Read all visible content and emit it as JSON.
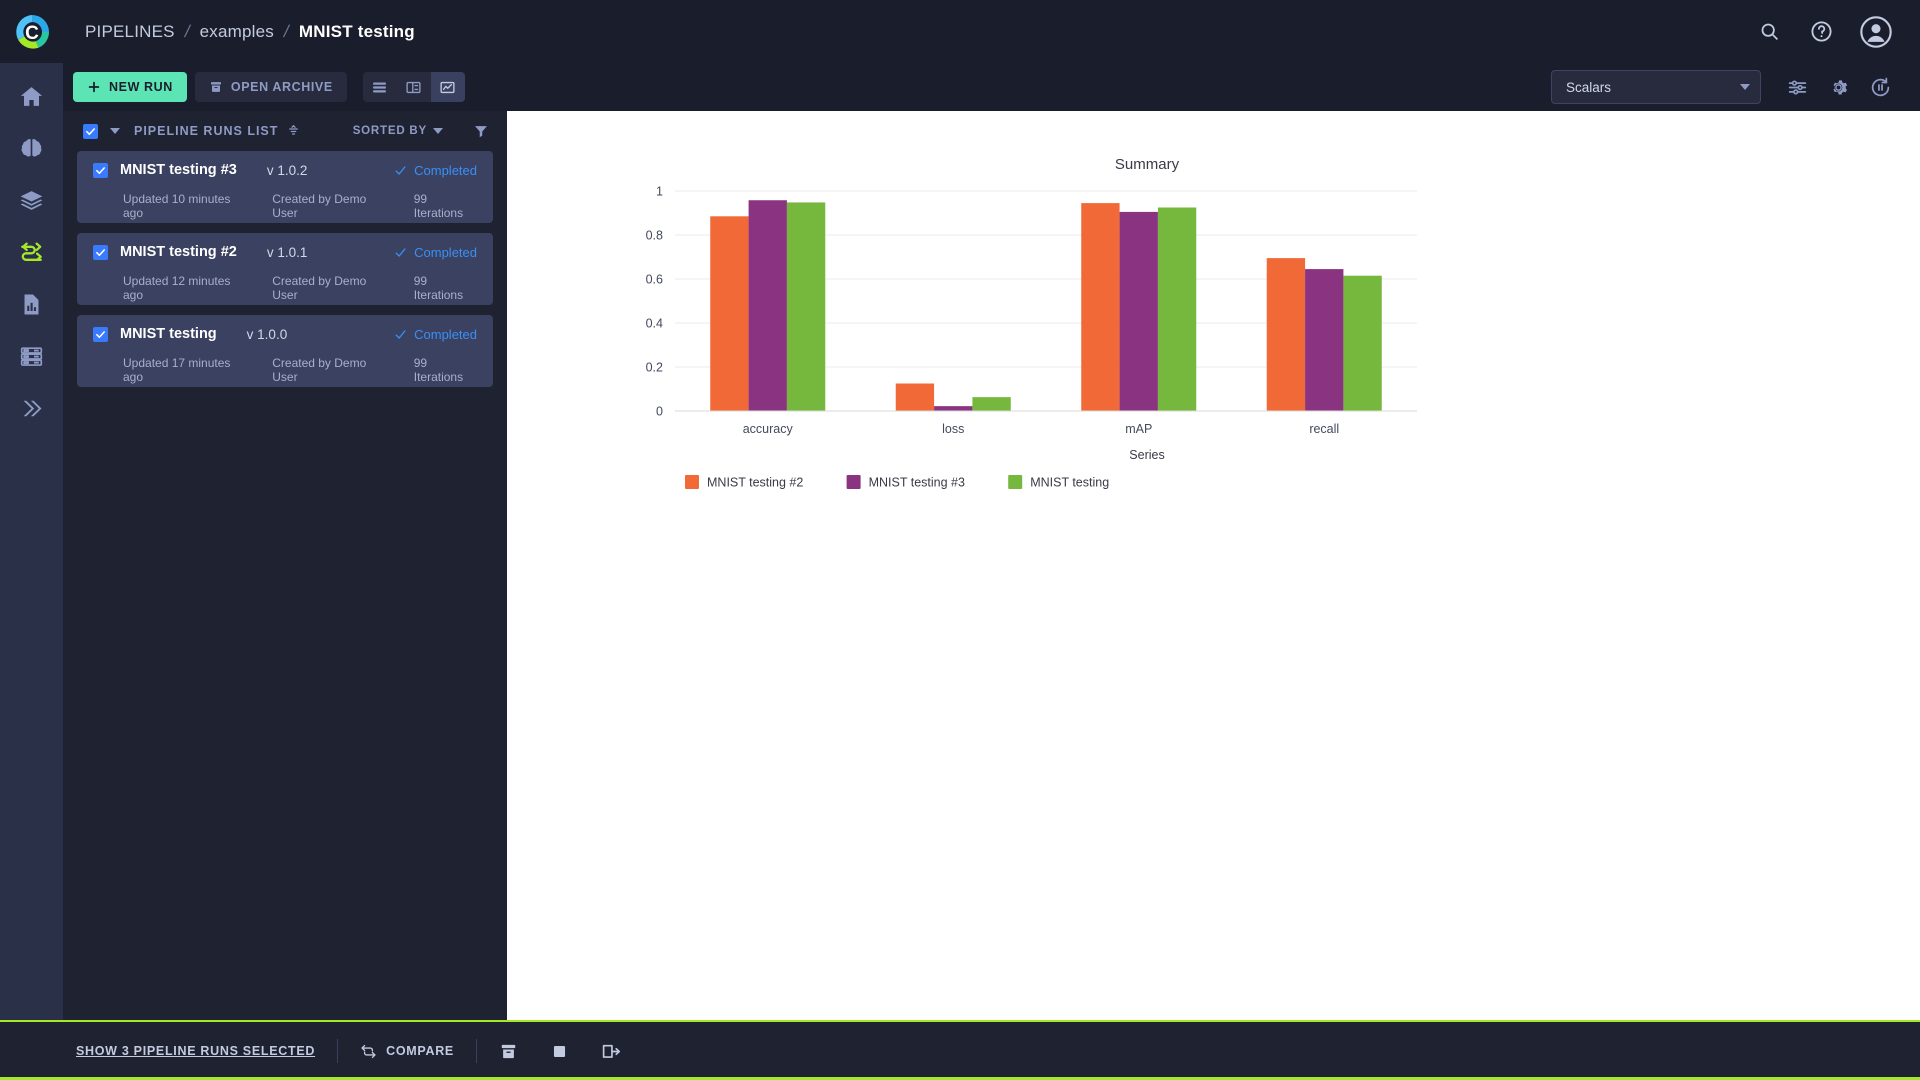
{
  "header": {
    "breadcrumb": [
      {
        "label": "PIPELINES",
        "last": false
      },
      {
        "label": "examples",
        "last": false
      },
      {
        "label": "MNIST testing",
        "last": true
      }
    ],
    "separator": "/",
    "icons": [
      "search-icon",
      "help-icon",
      "account-icon"
    ]
  },
  "sidebar": {
    "items": [
      {
        "name": "home",
        "label": "Home",
        "active": false
      },
      {
        "name": "projects",
        "label": "Projects",
        "active": false
      },
      {
        "name": "datasets",
        "label": "Datasets",
        "active": false
      },
      {
        "name": "pipelines",
        "label": "Pipelines",
        "active": true
      },
      {
        "name": "reports",
        "label": "Reports",
        "active": false
      },
      {
        "name": "workers",
        "label": "Workers and Queues",
        "active": false
      },
      {
        "name": "applications",
        "label": "Applications",
        "active": false
      }
    ]
  },
  "toolbar": {
    "new_run_label": "NEW RUN",
    "open_archive_label": "OPEN ARCHIVE",
    "views": [
      {
        "name": "table-view",
        "active": false
      },
      {
        "name": "details-view",
        "active": false
      },
      {
        "name": "chart-view",
        "active": true
      }
    ]
  },
  "runs_list": {
    "title": "PIPELINE RUNS LIST",
    "sorted_by_label": "SORTED BY",
    "select_all_checked": true,
    "runs": [
      {
        "name": "MNIST testing #3",
        "version": "v 1.0.2",
        "status": "Completed",
        "updated": "Updated 10 minutes ago",
        "created_by": "Created by Demo User",
        "iterations": "99 Iterations",
        "checked": true
      },
      {
        "name": "MNIST testing #2",
        "version": "v 1.0.1",
        "status": "Completed",
        "updated": "Updated 12 minutes ago",
        "created_by": "Created by Demo User",
        "iterations": "99 Iterations",
        "checked": true
      },
      {
        "name": "MNIST testing",
        "version": "v 1.0.0",
        "status": "Completed",
        "updated": "Updated 17 minutes ago",
        "created_by": "Created by Demo User",
        "iterations": "99 Iterations",
        "checked": true
      }
    ]
  },
  "main_toolbar": {
    "metric_select_value": "Scalars",
    "icons": [
      "sliders-icon",
      "gear-icon",
      "refresh-pause-icon"
    ]
  },
  "bottom_bar": {
    "selection_label": "SHOW 3 PIPELINE RUNS SELECTED",
    "compare_label": "COMPARE",
    "icons": [
      "archive-icon",
      "stop-icon",
      "move-icon"
    ]
  },
  "chart_data": {
    "type": "bar",
    "title": "Summary",
    "xlabel": "Series",
    "ylabel": "",
    "categories": [
      "accuracy",
      "loss",
      "mAP",
      "recall"
    ],
    "ylim": [
      0,
      1
    ],
    "yticks": [
      0,
      0.2,
      0.4,
      0.6,
      0.8,
      1
    ],
    "ytick_labels": [
      "0",
      "0.2",
      "0.4",
      "0.6",
      "0.8",
      "1"
    ],
    "grid": true,
    "legend_position": "bottom",
    "series": [
      {
        "name": "MNIST testing #2",
        "color": "#F26938",
        "values": [
          0.885,
          0.125,
          0.945,
          0.695
        ]
      },
      {
        "name": "MNIST testing #3",
        "color": "#8A3380",
        "values": [
          0.958,
          0.022,
          0.905,
          0.645
        ]
      },
      {
        "name": "MNIST testing",
        "color": "#76B73E",
        "values": [
          0.948,
          0.063,
          0.925,
          0.615
        ]
      }
    ]
  }
}
